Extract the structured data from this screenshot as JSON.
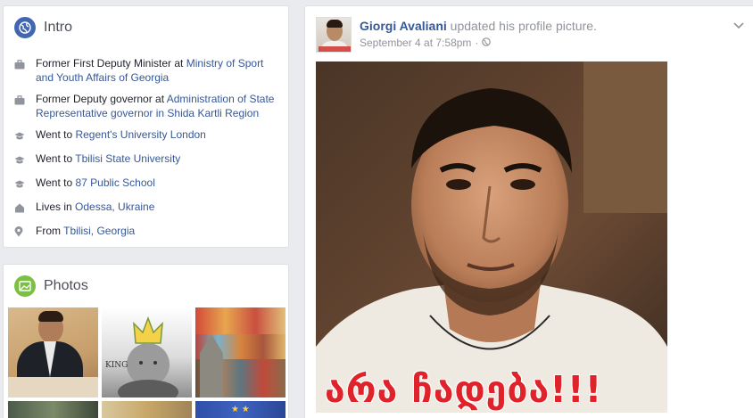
{
  "intro": {
    "title": "Intro",
    "icon": "globe-icon",
    "items": [
      {
        "icon": "briefcase-icon",
        "prefix": "Former First Deputy Minister at ",
        "link": "Ministry of Sport and Youth Affairs of Georgia"
      },
      {
        "icon": "briefcase-icon",
        "prefix": "Former Deputy governor at ",
        "link": "Administration of State Representative governor in Shida Kartli Region"
      },
      {
        "icon": "graduation-cap-icon",
        "prefix": "Went to ",
        "link": "Regent's University London"
      },
      {
        "icon": "graduation-cap-icon",
        "prefix": "Went to ",
        "link": "Tbilisi State University"
      },
      {
        "icon": "graduation-cap-icon",
        "prefix": "Went to ",
        "link": "87 Public School"
      },
      {
        "icon": "home-icon",
        "prefix": "Lives in ",
        "link": "Odessa, Ukraine"
      },
      {
        "icon": "map-pin-icon",
        "prefix": "From ",
        "link": "Tbilisi, Georgia"
      }
    ]
  },
  "photos": {
    "title": "Photos",
    "icon": "photo-icon",
    "king_label": "KING"
  },
  "post": {
    "author": "Giorgi Avaliani",
    "action": " updated his profile picture.",
    "timestamp": "September 4 at 7:58pm",
    "separator": "·",
    "privacy_icon": "globe-icon",
    "menu_icon": "chevron-down-icon",
    "caption": "არა ჩადება!!!"
  },
  "colors": {
    "link": "#365899",
    "meta": "#90949c",
    "intro_icon_bg": "#4267b2",
    "photos_icon_bg": "#7bc043",
    "caption": "#e0222a"
  }
}
